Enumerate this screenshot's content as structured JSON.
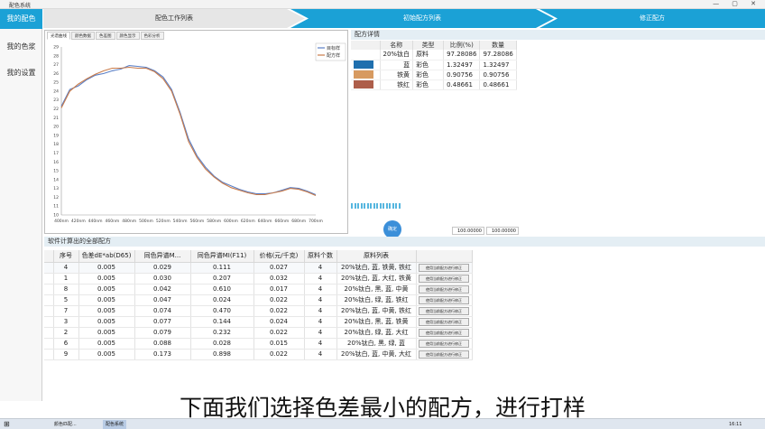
{
  "window": {
    "title": "配色系统",
    "controls": "— ▢ ✕"
  },
  "sidebar": {
    "items": [
      {
        "label": "我的配色",
        "active": true
      },
      {
        "label": "我的色浆",
        "active": false
      },
      {
        "label": "我的设置",
        "active": false
      }
    ]
  },
  "steps": [
    "配色工作列表",
    "初始配方列表",
    "修正配方"
  ],
  "chart_panel": {
    "tabs": [
      "光谱曲线",
      "颜色数据",
      "色差图",
      "颜色显示",
      "色彩分析"
    ]
  },
  "chart_data": {
    "type": "line",
    "title": "",
    "xlabel": "",
    "ylabel": "",
    "x_tick_labels": [
      "400nm",
      "420nm",
      "440nm",
      "460nm",
      "480nm",
      "500nm",
      "520nm",
      "540nm",
      "560nm",
      "580nm",
      "600nm",
      "620nm",
      "640nm",
      "660nm",
      "680nm",
      "700nm"
    ],
    "y_tick_labels": [
      "10",
      "11",
      "12",
      "13",
      "14",
      "15",
      "16",
      "17",
      "18",
      "19",
      "20",
      "21",
      "22",
      "23",
      "24",
      "25",
      "26",
      "27",
      "28",
      "29"
    ],
    "ylim": [
      10,
      29
    ],
    "x": [
      400,
      410,
      420,
      430,
      440,
      450,
      460,
      470,
      480,
      490,
      500,
      510,
      520,
      530,
      540,
      550,
      560,
      570,
      580,
      590,
      600,
      610,
      620,
      630,
      640,
      650,
      660,
      670,
      680,
      690,
      700
    ],
    "series": [
      {
        "name": "目标样",
        "color": "#5a7fc6",
        "values": [
          22.3,
          24.2,
          24.6,
          25.3,
          25.8,
          26.0,
          26.3,
          26.5,
          26.9,
          26.8,
          26.7,
          26.3,
          25.6,
          24.2,
          21.6,
          18.6,
          16.7,
          15.4,
          14.4,
          13.7,
          13.3,
          12.9,
          12.6,
          12.4,
          12.4,
          12.5,
          12.8,
          13.1,
          13.0,
          12.7,
          12.3
        ]
      },
      {
        "name": "配方样",
        "color": "#c97b4a",
        "values": [
          22.1,
          24.0,
          24.8,
          25.4,
          25.9,
          26.3,
          26.6,
          26.6,
          26.7,
          26.6,
          26.6,
          26.2,
          25.4,
          24.0,
          21.4,
          18.3,
          16.5,
          15.2,
          14.3,
          13.6,
          13.1,
          12.8,
          12.5,
          12.3,
          12.3,
          12.5,
          12.7,
          13.0,
          12.9,
          12.6,
          12.2
        ]
      }
    ],
    "legend": "top-right",
    "grid": false
  },
  "formula_detail": {
    "title": "配方详情",
    "columns": [
      "名称",
      "类型",
      "比例(%)",
      "数量"
    ],
    "rows": [
      {
        "name": "20%钛白",
        "type": "原料",
        "ratio": "97.28086",
        "qty": "97.28086",
        "color": ""
      },
      {
        "name": "蓝",
        "type": "彩色",
        "ratio": "1.32497",
        "qty": "1.32497",
        "color": "#1f6fae"
      },
      {
        "name": "铁黄",
        "type": "彩色",
        "ratio": "0.90756",
        "qty": "0.90756",
        "color": "#d79a60"
      },
      {
        "name": "铁红",
        "type": "彩色",
        "ratio": "0.48661",
        "qty": "0.48661",
        "color": "#ad5e4a"
      }
    ],
    "round_button": "确定",
    "total_ratio": "100.00000",
    "total_qty": "100.00000"
  },
  "recipes": {
    "title": "软件计算出的全部配方",
    "columns": [
      "序号",
      "色差dE*ab(D65)",
      "同色异谱M...",
      "同色异谱MI(F11)",
      "价格(元/千克)",
      "原料个数",
      "原料列表",
      ""
    ],
    "action_label": "使用当前配方进行修正",
    "rows": [
      {
        "no": "4",
        "de": "0.005",
        "mi1": "0.029",
        "mi2": "0.111",
        "price": "0.027",
        "count": "4",
        "list": "20%钛白, 蓝, 铁黄, 铁红"
      },
      {
        "no": "1",
        "de": "0.005",
        "mi1": "0.030",
        "mi2": "0.207",
        "price": "0.032",
        "count": "4",
        "list": "20%钛白, 蓝, 大红, 铁黄"
      },
      {
        "no": "8",
        "de": "0.005",
        "mi1": "0.042",
        "mi2": "0.610",
        "price": "0.017",
        "count": "4",
        "list": "20%钛白, 黑, 蓝, 中黄"
      },
      {
        "no": "5",
        "de": "0.005",
        "mi1": "0.047",
        "mi2": "0.024",
        "price": "0.022",
        "count": "4",
        "list": "20%钛白, 绿, 蓝, 铁红"
      },
      {
        "no": "7",
        "de": "0.005",
        "mi1": "0.074",
        "mi2": "0.470",
        "price": "0.022",
        "count": "4",
        "list": "20%钛白, 蓝, 中黄, 铁红"
      },
      {
        "no": "3",
        "de": "0.005",
        "mi1": "0.077",
        "mi2": "0.144",
        "price": "0.024",
        "count": "4",
        "list": "20%钛白, 黑, 蓝, 铁黄"
      },
      {
        "no": "2",
        "de": "0.005",
        "mi1": "0.079",
        "mi2": "0.232",
        "price": "0.022",
        "count": "4",
        "list": "20%钛白, 绿, 蓝, 大红"
      },
      {
        "no": "6",
        "de": "0.005",
        "mi1": "0.088",
        "mi2": "0.028",
        "price": "0.015",
        "count": "4",
        "list": "20%钛白, 黑, 绿, 蓝"
      },
      {
        "no": "9",
        "de": "0.005",
        "mi1": "0.173",
        "mi2": "0.898",
        "price": "0.022",
        "count": "4",
        "list": "20%钛白, 蓝, 中黄, 大红"
      }
    ]
  },
  "caption": "下面我们选择色差最小的配方，进行打样",
  "taskbar": {
    "app1": "颜色匹配...",
    "app2": "配色系统",
    "time": "16:11"
  }
}
